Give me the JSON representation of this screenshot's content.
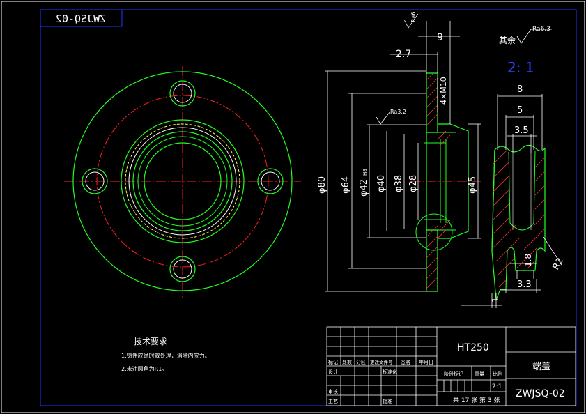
{
  "title_box": {
    "mirrored_code": "ZWJSQ-02"
  },
  "roughness": {
    "top": "Ra6",
    "rest_label": "其余",
    "rest_value": "Ra6.3",
    "mid": "Ra3.2"
  },
  "scale": "2: 1",
  "dims_side": {
    "d9": "9",
    "d2_7": "2.7",
    "thread": "4×M10",
    "phi80": "φ80",
    "phi64": "φ64",
    "phi42": "φ42",
    "phi42_sub": "H8",
    "phi40": "φ40",
    "phi38": "φ38",
    "phi28": "φ28",
    "phi45": "φ45"
  },
  "dims_detail": {
    "d8": "8",
    "d5": "5",
    "d3_5": "3.5",
    "d1_8": "1.8",
    "d3_3": "3.3",
    "d1": "1",
    "r2": "R2"
  },
  "tech_req": {
    "title": "技术要求",
    "line1": "1.铸件应经时效处理，消除内应力。",
    "line2": "2.未注圆角为R1。"
  },
  "title_block": {
    "material": "HT250",
    "part_name": "端盖",
    "drawing_no": "ZWJSQ-02",
    "marker": "标记",
    "count": "处数",
    "zone": "分区",
    "change_doc": "更改文件号",
    "signature": "签名",
    "date": "年月日",
    "design": "设计",
    "standardize": "标准化",
    "review": "审核",
    "process": "工艺",
    "approve": "批准",
    "stage": "阶段标记",
    "weight": "重量",
    "ratio_label": "比例",
    "ratio_value": "2:1",
    "sheets": "共 17 张 第 3 张"
  }
}
